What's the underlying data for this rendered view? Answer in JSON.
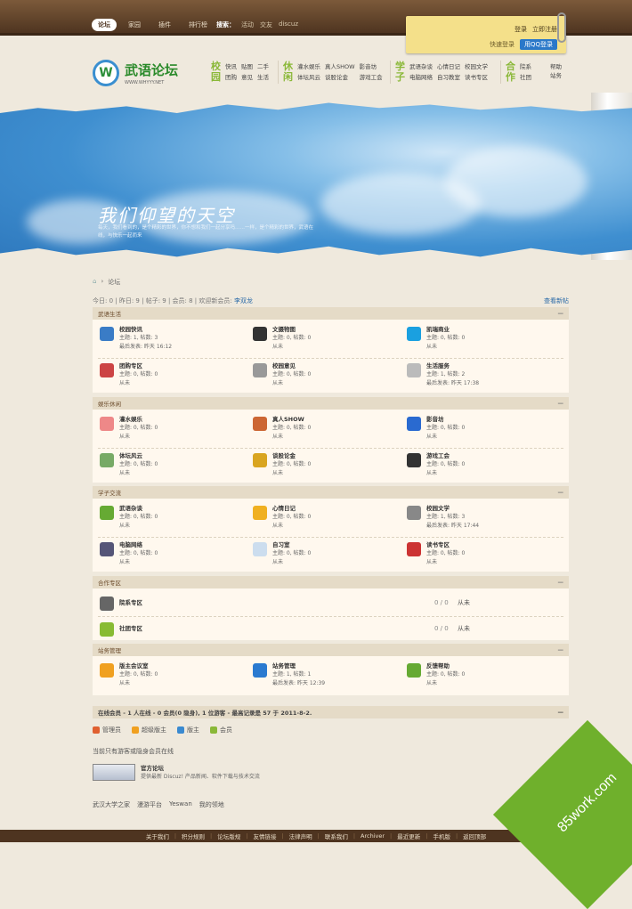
{
  "topnav": {
    "tabs": [
      "论坛",
      "家园",
      "插件",
      "排行榜"
    ],
    "search_label": "搜索：",
    "search_links": [
      "活动",
      "交友",
      "discuz"
    ]
  },
  "login": {
    "login": "登录",
    "register": "立即注册",
    "quick": "快速登录",
    "qq": "用QQ登录"
  },
  "logo": {
    "text": "武语论坛",
    "sub": "WWW.WHYYY.NET"
  },
  "catnav": [
    {
      "title": "校园",
      "links": [
        "快讯",
        "贴图",
        "二手",
        "团购",
        "意见",
        "生活"
      ]
    },
    {
      "title": "休闲",
      "links": [
        "灌水娱乐",
        "真人SHOW",
        "影音坊",
        "体坛风云",
        "谈股论金",
        "游戏工会"
      ]
    },
    {
      "title": "学子",
      "links": [
        "武语杂谈",
        "心情日记",
        "校园文学",
        "电脑网络",
        "自习教室",
        "读书专区"
      ]
    },
    {
      "title": "合作",
      "links": [
        "院系",
        "社团"
      ]
    }
  ],
  "help": "帮助站务",
  "banner": {
    "title": "我们仰望的天空",
    "sub": "每天，我们看到的，是个精彩的世界，你不想和我们一起分享吗……一样，是个精彩的世界，武语在线，与快乐一起而来"
  },
  "breadcrumb": {
    "current": "论坛"
  },
  "stats": {
    "text": "今日: 0 | 昨日: 9 | 帖子: 9 | 会员: 8 | 欢迎新会员:",
    "newest": "李双龙",
    "new_posts": "查看新帖"
  },
  "sections": [
    {
      "title": "武语生活",
      "forums": [
        {
          "name": "校园快讯",
          "l1": "主题: 1, 帖数: 3",
          "l2": "最后发表: 昨天 16:12",
          "icon": "news-icon",
          "color": "#3a7cc6"
        },
        {
          "name": "文摄物图",
          "l1": "主题: 0, 帖数: 0",
          "l2": "从未",
          "icon": "camera-icon",
          "color": "#333"
        },
        {
          "name": "凯瑞商业",
          "l1": "主题: 0, 帖数: 0",
          "l2": "从未",
          "icon": "skype-icon",
          "color": "#1aa0e0"
        },
        {
          "name": "团购专区",
          "l1": "主题: 0, 帖数: 0",
          "l2": "从未",
          "icon": "cart-icon",
          "color": "#c44"
        },
        {
          "name": "校园意见",
          "l1": "主题: 0, 帖数: 0",
          "l2": "从未",
          "icon": "speaker-icon",
          "color": "#999"
        },
        {
          "name": "生活服务",
          "l1": "主题: 1, 帖数: 2",
          "l2": "最后发表: 昨天 17:38",
          "icon": "bulb-icon",
          "color": "#bbb"
        }
      ]
    },
    {
      "title": "娱乐休闲",
      "forums": [
        {
          "name": "灌水娱乐",
          "l1": "主题: 0, 帖数: 0",
          "l2": "从未",
          "icon": "chat-icon",
          "color": "#e88"
        },
        {
          "name": "真人SHOW",
          "l1": "主题: 0, 帖数: 0",
          "l2": "从未",
          "icon": "person-icon",
          "color": "#c63"
        },
        {
          "name": "影音坊",
          "l1": "主题: 0, 帖数: 0",
          "l2": "从未",
          "icon": "music-icon",
          "color": "#2a6ad0"
        },
        {
          "name": "体坛风云",
          "l1": "主题: 0, 帖数: 0",
          "l2": "从未",
          "icon": "sport-icon",
          "color": "#7a6"
        },
        {
          "name": "谈股论金",
          "l1": "主题: 0, 帖数: 0",
          "l2": "从未",
          "icon": "coins-icon",
          "color": "#d9a520"
        },
        {
          "name": "游戏工会",
          "l1": "主题: 0, 帖数: 0",
          "l2": "从未",
          "icon": "gamepad-icon",
          "color": "#333"
        }
      ]
    },
    {
      "title": "学子交流",
      "forums": [
        {
          "name": "武语杂谈",
          "l1": "主题: 0, 帖数: 0",
          "l2": "从未",
          "icon": "gift-icon",
          "color": "#6a3"
        },
        {
          "name": "心情日记",
          "l1": "主题: 0, 帖数: 0",
          "l2": "从未",
          "icon": "heart-icon",
          "color": "#f0b020"
        },
        {
          "name": "校园文学",
          "l1": "主题: 1, 帖数: 3",
          "l2": "最后发表: 昨天 17:44",
          "icon": "book-icon",
          "color": "#888"
        },
        {
          "name": "电脑网络",
          "l1": "主题: 0, 帖数: 0",
          "l2": "从未",
          "icon": "monitor-icon",
          "color": "#557"
        },
        {
          "name": "自习室",
          "l1": "主题: 0, 帖数: 0",
          "l2": "从未",
          "icon": "note-icon",
          "color": "#cde"
        },
        {
          "name": "读书专区",
          "l1": "主题: 0, 帖数: 0",
          "l2": "从未",
          "icon": "books-icon",
          "color": "#c33"
        }
      ]
    }
  ],
  "coop": {
    "title": "合作专区",
    "rows": [
      {
        "name": "院系专区",
        "count": "0 / 0",
        "last": "从未",
        "icon": "group-icon",
        "color": "#666"
      },
      {
        "name": "社团专区",
        "count": "0 / 0",
        "last": "从未",
        "icon": "map-icon",
        "color": "#8b3"
      }
    ]
  },
  "admin": {
    "title": "站务管理",
    "forums": [
      {
        "name": "版主会议室",
        "l1": "主题: 0, 帖数: 0",
        "l2": "从未",
        "icon": "badge-icon",
        "color": "#f0a020"
      },
      {
        "name": "站务管理",
        "l1": "主题: 1, 帖数: 1",
        "l2": "最后发表: 昨天 12:39",
        "icon": "settings-icon",
        "color": "#2a7ad0"
      },
      {
        "name": "反馈帮助",
        "l1": "主题: 0, 帖数: 0",
        "l2": "从未",
        "icon": "help-icon",
        "color": "#6a3"
      }
    ]
  },
  "online": {
    "text": "在线会员 - 1 人在线 - 0 会员(0 隐身), 1 位游客 - 最高记录是 57 于 2011-8-2.",
    "collapse": "—"
  },
  "legend": [
    {
      "label": "管理员",
      "color": "#e06030"
    },
    {
      "label": "超级版主",
      "color": "#f0a020"
    },
    {
      "label": "版主",
      "color": "#3a8ad0"
    },
    {
      "label": "会员",
      "color": "#8ab838"
    }
  ],
  "online_note": "当前只有游客或隐身会员在线",
  "official": {
    "name": "官方论坛",
    "desc": "提供最新 Discuz! 产品新闻、软件下载与技术交流"
  },
  "friend_links": [
    "武汉大学之家",
    "漫游平台",
    "Yeswan",
    "我的领地"
  ],
  "footer": [
    "关于我们",
    "积分规则",
    "论坛版规",
    "友情链接",
    "法律声明",
    "联系我们",
    "Archiver",
    "最近更新",
    "手机版",
    "返回顶部"
  ],
  "watermark": "85work.com"
}
